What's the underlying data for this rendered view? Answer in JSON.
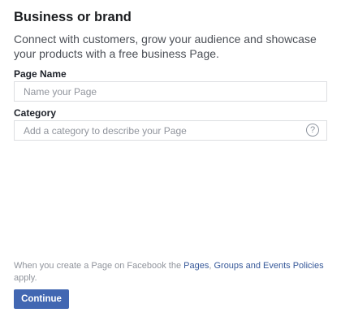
{
  "header": {
    "title": "Business or brand",
    "description": "Connect with customers, grow your audience and showcase your products with a free business Page."
  },
  "form": {
    "page_name": {
      "label": "Page Name",
      "placeholder": "Name your Page",
      "value": ""
    },
    "category": {
      "label": "Category",
      "placeholder": "Add a category to describe your Page",
      "value": "",
      "help_icon": "?"
    }
  },
  "footer": {
    "policy_prefix": "When you create a Page on Facebook the ",
    "link_pages": "Pages",
    "separator": ", ",
    "link_groups_events": "Groups and Events Policies",
    "policy_suffix": " apply.",
    "continue_label": "Continue"
  },
  "colors": {
    "button": "#4267b2",
    "link": "#365899",
    "muted_text": "#90949c"
  }
}
